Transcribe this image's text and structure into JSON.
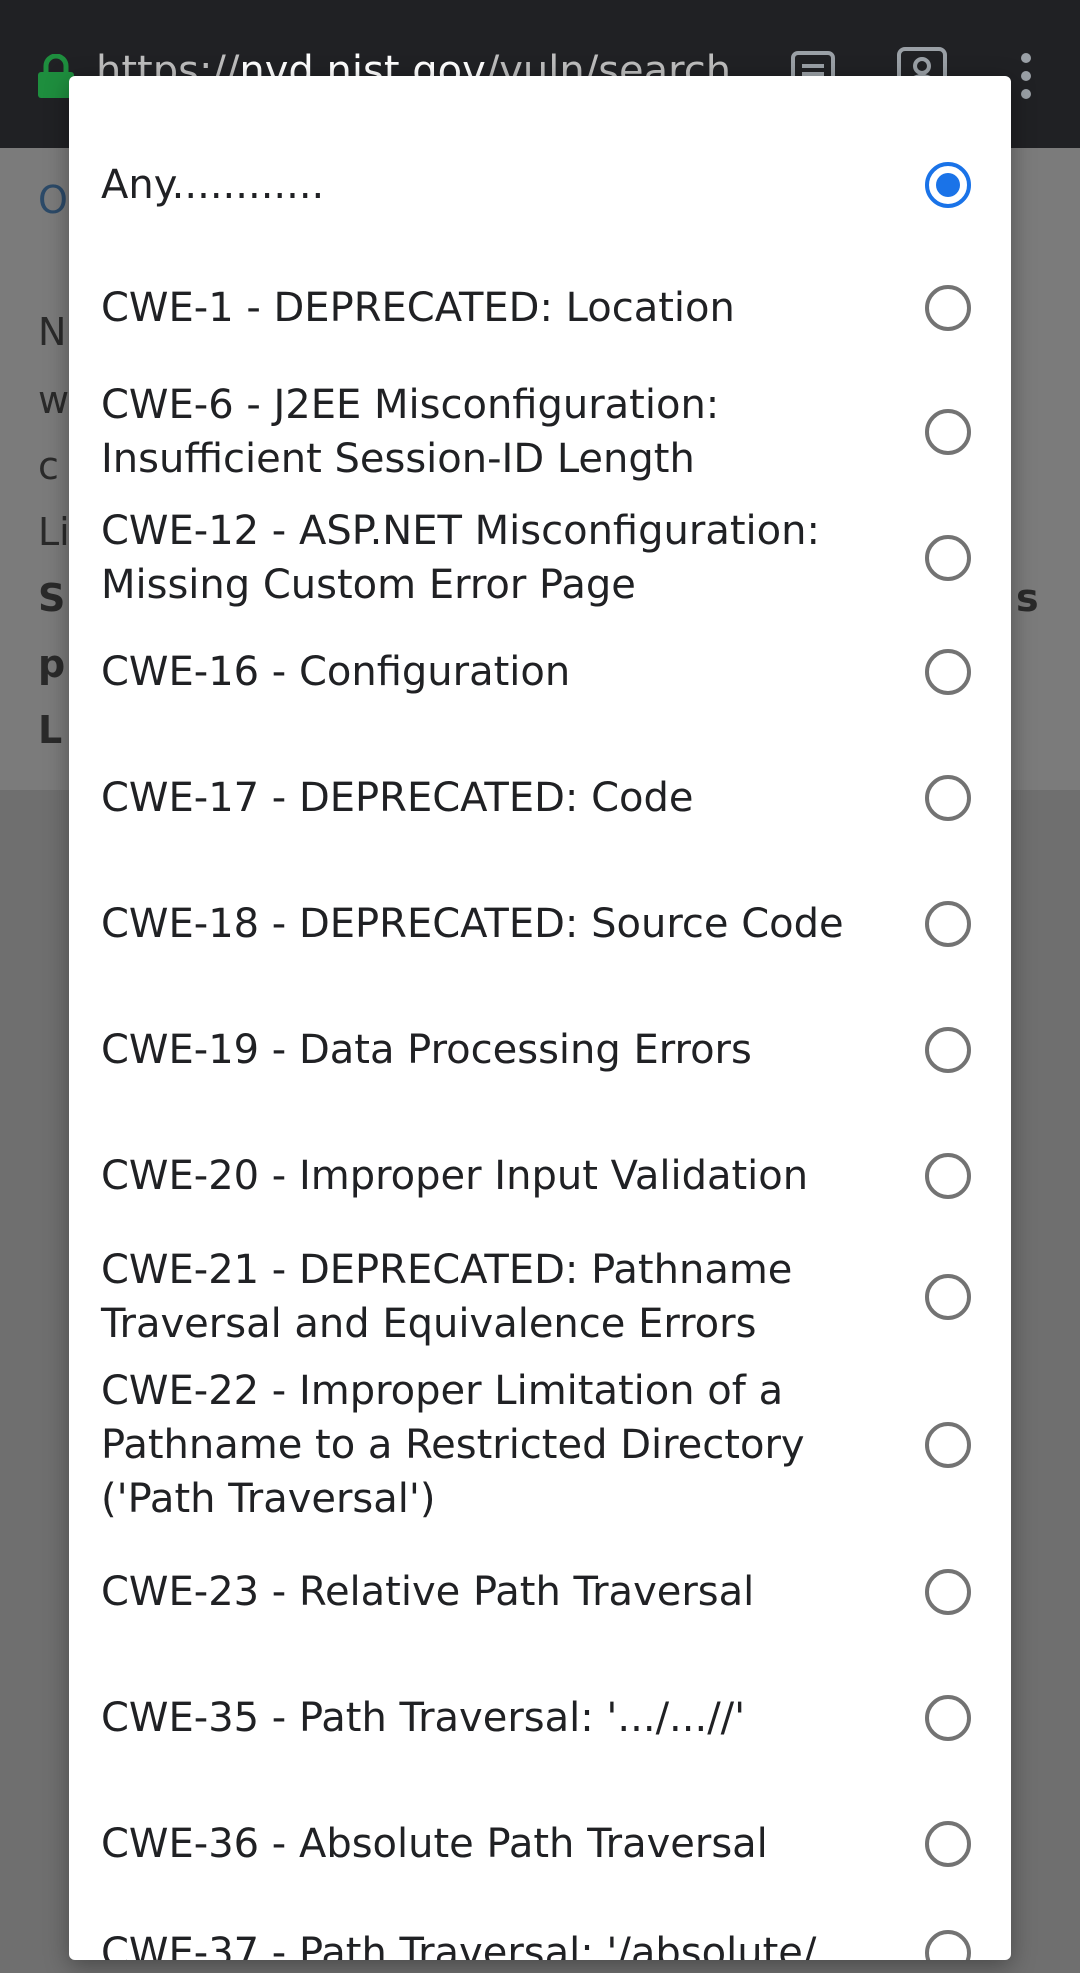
{
  "browser": {
    "url_prefix": "https://",
    "url_host": "nvd.nist.gov",
    "url_path": "/vuln/search",
    "lock_icon": "lock-icon",
    "tab_icon": "tab-switcher-icon",
    "profile_icon": "profile-icon",
    "menu_icon": "more-vertical-icon",
    "lock_color": "#1e8e3e"
  },
  "background_fragments": [
    "O",
    "N",
    "w",
    "c",
    "Li",
    "S",
    "s",
    "p",
    "L"
  ],
  "dialog": {
    "accent_color": "#1a73e8",
    "options": [
      {
        "label": "Any............",
        "checked": true
      },
      {
        "label": "CWE-1 - DEPRECATED: Location",
        "checked": false
      },
      {
        "label": "CWE-6 - J2EE Misconfiguration: Insufficient Session-ID Length",
        "checked": false
      },
      {
        "label": "CWE-12 - ASP.NET Misconfiguration: Missing Custom Error Page",
        "checked": false
      },
      {
        "label": "CWE-16 - Configuration",
        "checked": false
      },
      {
        "label": "CWE-17 - DEPRECATED: Code",
        "checked": false
      },
      {
        "label": "CWE-18 - DEPRECATED: Source Code",
        "checked": false
      },
      {
        "label": "CWE-19 - Data Processing Errors",
        "checked": false
      },
      {
        "label": "CWE-20 - Improper Input Validation",
        "checked": false
      },
      {
        "label": "CWE-21 - DEPRECATED: Pathname Traversal and Equivalence Errors",
        "checked": false
      },
      {
        "label": "CWE-22 - Improper Limitation of a Pathname to a Restricted Directory ('Path Traversal')",
        "checked": false
      },
      {
        "label": "CWE-23 - Relative Path Traversal",
        "checked": false
      },
      {
        "label": "CWE-35 - Path Traversal: '.../...//'",
        "checked": false
      },
      {
        "label": "CWE-36 - Absolute Path Traversal",
        "checked": false
      },
      {
        "label": "CWE-37 - Path Traversal: '/absolute/",
        "checked": false
      }
    ]
  }
}
